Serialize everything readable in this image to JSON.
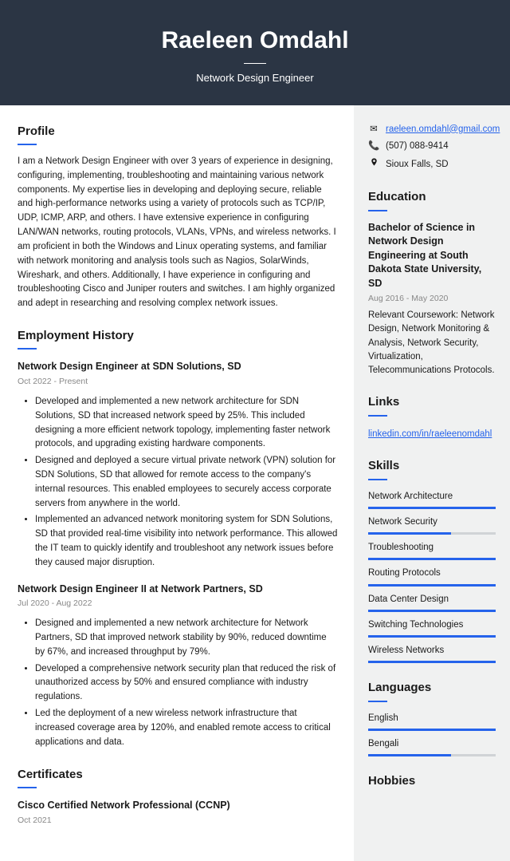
{
  "header": {
    "name": "Raeleen Omdahl",
    "title": "Network Design Engineer"
  },
  "profile": {
    "heading": "Profile",
    "text": "I am a Network Design Engineer with over 3 years of experience in designing, configuring, implementing, troubleshooting and maintaining various network components. My expertise lies in developing and deploying secure, reliable and high-performance networks using a variety of protocols such as TCP/IP, UDP, ICMP, ARP, and others. I have extensive experience in configuring LAN/WAN networks, routing protocols, VLANs, VPNs, and wireless networks. I am proficient in both the Windows and Linux operating systems, and familiar with network monitoring and analysis tools such as Nagios, SolarWinds, Wireshark, and others. Additionally, I have experience in configuring and troubleshooting Cisco and Juniper routers and switches. I am highly organized and adept in researching and resolving complex network issues."
  },
  "employment": {
    "heading": "Employment History",
    "jobs": [
      {
        "title": "Network Design Engineer at SDN Solutions, SD",
        "date": "Oct 2022 - Present",
        "bullets": [
          "Developed and implemented a new network architecture for SDN Solutions, SD that increased network speed by 25%. This included designing a more efficient network topology, implementing faster network protocols, and upgrading existing hardware components.",
          "Designed and deployed a secure virtual private network (VPN) solution for SDN Solutions, SD that allowed for remote access to the company's internal resources. This enabled employees to securely access corporate servers from anywhere in the world.",
          "Implemented an advanced network monitoring system for SDN Solutions, SD that provided real-time visibility into network performance. This allowed the IT team to quickly identify and troubleshoot any network issues before they caused major disruption."
        ]
      },
      {
        "title": "Network Design Engineer II at Network Partners, SD",
        "date": "Jul 2020 - Aug 2022",
        "bullets": [
          "Designed and implemented a new network architecture for Network Partners, SD that improved network stability by 90%, reduced downtime by 67%, and increased throughput by 79%.",
          "Developed a comprehensive network security plan that reduced the risk of unauthorized access by 50% and ensured compliance with industry regulations.",
          "Led the deployment of a new wireless network infrastructure that increased coverage area by 120%, and enabled remote access to critical applications and data."
        ]
      }
    ]
  },
  "certificates": {
    "heading": "Certificates",
    "items": [
      {
        "title": "Cisco Certified Network Professional (CCNP)",
        "date": "Oct 2021"
      }
    ]
  },
  "contact": {
    "email": "raeleen.omdahl@gmail.com",
    "phone": "(507) 088-9414",
    "location": "Sioux Falls, SD"
  },
  "education": {
    "heading": "Education",
    "title": "Bachelor of Science in Network Design Engineering at South Dakota State University, SD",
    "date": "Aug 2016 - May 2020",
    "text": "Relevant Coursework: Network Design, Network Monitoring & Analysis, Network Security, Virtualization, Telecommunications Protocols."
  },
  "links": {
    "heading": "Links",
    "url": "linkedin.com/in/raeleenomdahl"
  },
  "skills": {
    "heading": "Skills",
    "items": [
      {
        "name": "Network Architecture",
        "level": 100
      },
      {
        "name": "Network Security",
        "level": 65
      },
      {
        "name": "Troubleshooting",
        "level": 100
      },
      {
        "name": "Routing Protocols",
        "level": 100
      },
      {
        "name": "Data Center Design",
        "level": 100
      },
      {
        "name": "Switching Technologies",
        "level": 100
      },
      {
        "name": "Wireless Networks",
        "level": 100
      }
    ]
  },
  "languages": {
    "heading": "Languages",
    "items": [
      {
        "name": "English",
        "level": 100
      },
      {
        "name": "Bengali",
        "level": 65
      }
    ]
  },
  "hobbies": {
    "heading": "Hobbies"
  }
}
